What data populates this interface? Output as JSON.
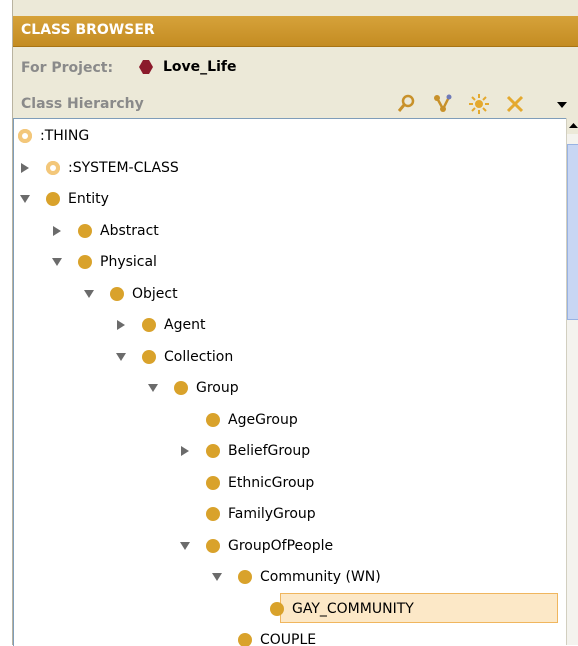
{
  "header": {
    "title": "CLASS BROWSER"
  },
  "project": {
    "label": "For Project:",
    "name": "Love_Life"
  },
  "hierarchy": {
    "label": "Class Hierarchy",
    "tools": [
      "find-class-icon",
      "create-subclass-icon",
      "create-class-icon",
      "delete-class-icon",
      "menu-dropdown-icon"
    ]
  },
  "tree": {
    "nodes": [
      {
        "label": ":THING",
        "depth": 0,
        "toggle": "none",
        "kind": "system"
      },
      {
        "label": ":SYSTEM-CLASS",
        "depth": 1,
        "toggle": "collapsed",
        "kind": "system"
      },
      {
        "label": "Entity",
        "depth": 1,
        "toggle": "expanded",
        "kind": "class"
      },
      {
        "label": "Abstract",
        "depth": 2,
        "toggle": "collapsed",
        "kind": "class"
      },
      {
        "label": "Physical",
        "depth": 2,
        "toggle": "expanded",
        "kind": "class"
      },
      {
        "label": "Object",
        "depth": 3,
        "toggle": "expanded",
        "kind": "class"
      },
      {
        "label": "Agent",
        "depth": 4,
        "toggle": "collapsed",
        "kind": "class"
      },
      {
        "label": "Collection",
        "depth": 4,
        "toggle": "expanded",
        "kind": "class"
      },
      {
        "label": "Group",
        "depth": 5,
        "toggle": "expanded",
        "kind": "class"
      },
      {
        "label": "AgeGroup",
        "depth": 6,
        "toggle": "none",
        "kind": "class"
      },
      {
        "label": "BeliefGroup",
        "depth": 6,
        "toggle": "collapsed",
        "kind": "class"
      },
      {
        "label": "EthnicGroup",
        "depth": 6,
        "toggle": "none",
        "kind": "class"
      },
      {
        "label": "FamilyGroup",
        "depth": 6,
        "toggle": "none",
        "kind": "class"
      },
      {
        "label": "GroupOfPeople",
        "depth": 6,
        "toggle": "expanded",
        "kind": "class"
      },
      {
        "label": "Community (WN)",
        "depth": 7,
        "toggle": "expanded",
        "kind": "class"
      },
      {
        "label": "GAY_COMMUNITY",
        "depth": 8,
        "toggle": "none",
        "kind": "class",
        "selected": true
      },
      {
        "label": "COUPLE",
        "depth": 7,
        "toggle": "none",
        "kind": "class"
      }
    ]
  },
  "colors": {
    "title_bar": "#c8912a",
    "class_dot": "#d9a22b",
    "system_dot": "#f3c77a",
    "project_icon": "#8b1a2b",
    "selection_bg": "#fce8c7",
    "selection_border": "#f0b65e"
  }
}
